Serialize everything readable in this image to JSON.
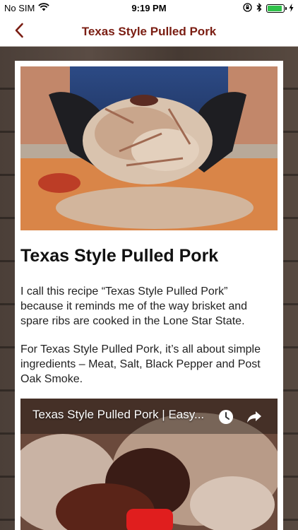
{
  "status_bar": {
    "carrier": "No SIM",
    "time": "9:19 PM",
    "wifi_icon": "wifi-icon",
    "lock_rotation_icon": "orientation-lock-icon",
    "bluetooth_icon": "bluetooth-icon",
    "battery_icon": "battery-icon",
    "battery_level": 0.9,
    "charging_icon": "charging-bolt-icon"
  },
  "nav": {
    "back_icon": "chevron-left-icon",
    "title": "Texas Style Pulled Pork",
    "accent_color": "#7a1d12"
  },
  "article": {
    "hero_image_alt": "pulled-pork-hero-image",
    "title": "Texas Style Pulled Pork",
    "paragraphs": [
      "I call this recipe “Texas Style Pulled Pork” because it reminds me of the way brisket and spare ribs are cooked in the Lone Star State.",
      "For Texas Style Pulled Pork, it’s all about simple ingredients – Meat, Salt, Black Pepper and Post Oak Smoke."
    ]
  },
  "video": {
    "title": "Texas Style Pulled Pork | Easy...",
    "watch_later_icon": "clock-icon",
    "share_icon": "share-arrow-icon",
    "play_button_color": "#e01e1e"
  }
}
